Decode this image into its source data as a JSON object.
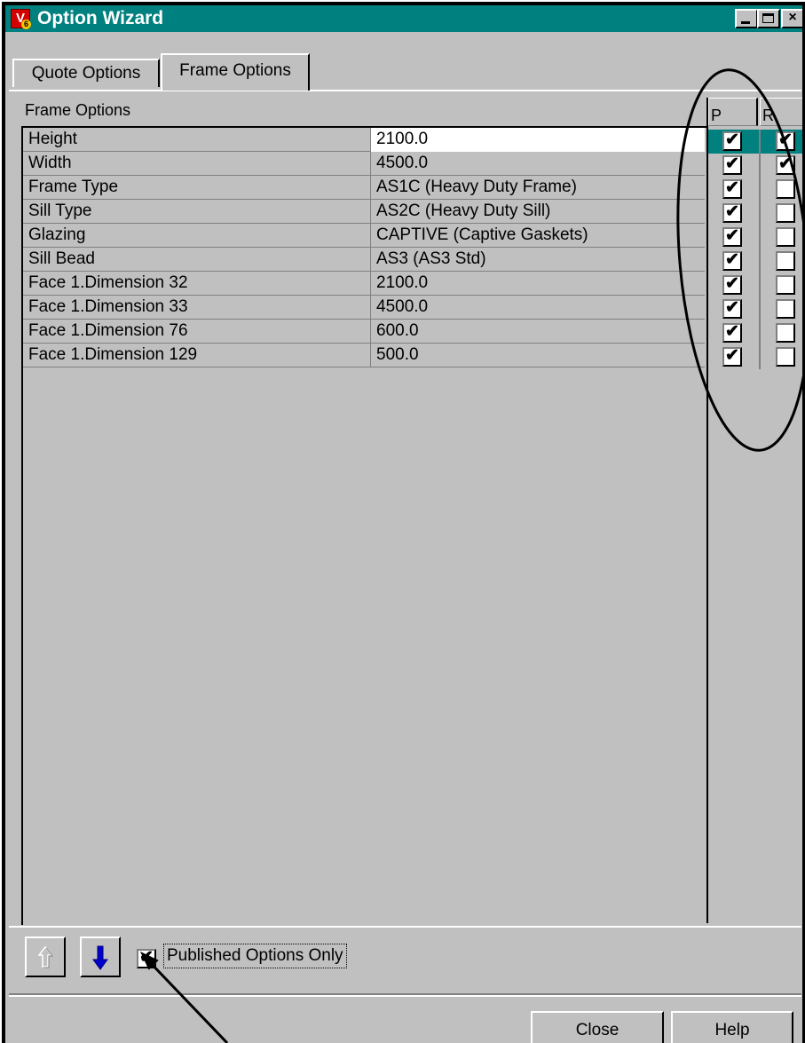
{
  "window": {
    "title": "Option Wizard",
    "icon_letter": "V",
    "icon_badge": "6",
    "title_buttons": [
      "minimize-icon",
      "maximize-icon",
      "close-icon"
    ],
    "close_glyph": "×"
  },
  "tabs": [
    {
      "label": "Quote Options",
      "selected": false
    },
    {
      "label": "Frame Options",
      "selected": true
    }
  ],
  "group_label": "Frame Options",
  "columns": {
    "p": "P",
    "r": "R"
  },
  "rows": [
    {
      "name": "Height",
      "value": "2100.0",
      "p": true,
      "r": true
    },
    {
      "name": "Width",
      "value": "4500.0",
      "p": true,
      "r": true
    },
    {
      "name": "Frame Type",
      "value": "AS1C (Heavy Duty Frame)",
      "p": true,
      "r": false
    },
    {
      "name": "Sill Type",
      "value": "AS2C (Heavy Duty Sill)",
      "p": true,
      "r": false
    },
    {
      "name": "Glazing",
      "value": "CAPTIVE (Captive Gaskets)",
      "p": true,
      "r": false
    },
    {
      "name": "Sill Bead",
      "value": "AS3 (AS3 Std)",
      "p": true,
      "r": false
    },
    {
      "name": "Face 1.Dimension 32",
      "value": "2100.0",
      "p": true,
      "r": false
    },
    {
      "name": "Face 1.Dimension 33",
      "value": "4500.0",
      "p": true,
      "r": false
    },
    {
      "name": "Face 1.Dimension 76",
      "value": "600.0",
      "p": true,
      "r": false
    },
    {
      "name": "Face 1.Dimension 129",
      "value": "500.0",
      "p": true,
      "r": false
    }
  ],
  "check_glyph": "✔",
  "bottom": {
    "published_only_label": "Published Options Only",
    "published_only_checked": true,
    "up_icon": "up-arrow-icon",
    "down_icon": "down-arrow-icon"
  },
  "buttons": {
    "close": "Close",
    "help": "Help"
  },
  "colors": {
    "titlebar": "#00807f",
    "face": "#c0c0c0",
    "selection": "#00807f",
    "down_arrow": "#0000cc"
  }
}
